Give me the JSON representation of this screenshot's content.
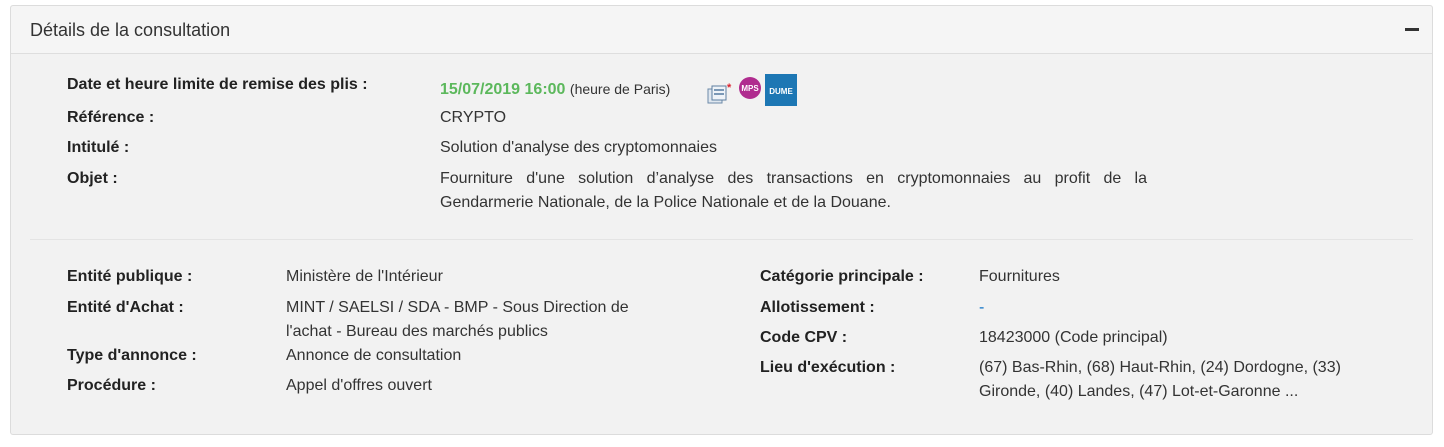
{
  "panel": {
    "title": "Détails de la consultation",
    "collapse_icon": "minus-icon"
  },
  "top": {
    "date_label": "Date et heure limite de remise des plis :",
    "date_value": "15/07/2019 16:00",
    "date_tz": "(heure de Paris)",
    "reference_label": "Référence :",
    "reference_value": "CRYPTO",
    "intitule_label": "Intitulé :",
    "intitule_value": "Solution d'analyse des cryptomonnaies",
    "objet_label": "Objet :",
    "objet_value_line1": "Fourniture d'une solution d’analyse des transactions en cryptomonnaies au profit de la",
    "objet_value_line2": "Gendarmerie Nationale, de la Police Nationale et de la Douane.",
    "icons": {
      "copies": "copies-icon",
      "mps": "MPS",
      "dume": "DUME"
    }
  },
  "left": {
    "entite_publique_label": "Entité publique :",
    "entite_publique_value": "Ministère de l'Intérieur",
    "entite_achat_label": "Entité d'Achat :",
    "entite_achat_value_line1": "MINT / SAELSI / SDA - BMP - Sous Direction de",
    "entite_achat_value_line2": "l'achat - Bureau des marchés publics",
    "type_annonce_label": "Type d'annonce :",
    "type_annonce_value": "Annonce de consultation",
    "procedure_label": "Procédure :",
    "procedure_value": "Appel d'offres ouvert"
  },
  "right": {
    "categorie_label": "Catégorie principale :",
    "categorie_value": "Fournitures",
    "allotissement_label": "Allotissement :",
    "allotissement_value": "-",
    "cpv_label": "Code CPV :",
    "cpv_value": "18423000 (Code principal)",
    "lieu_label": "Lieu d'exécution :",
    "lieu_value_line1": "(67) Bas-Rhin, (68) Haut-Rhin, (24) Dordogne, (33)",
    "lieu_value_line2": "Gironde, (40) Landes, (47) Lot-et-Garonne ..."
  },
  "colors": {
    "date_green": "#5cb85c",
    "link_blue": "#0b70c7",
    "mps_purple": "#b02c8f",
    "dume_blue": "#1d77b4"
  }
}
